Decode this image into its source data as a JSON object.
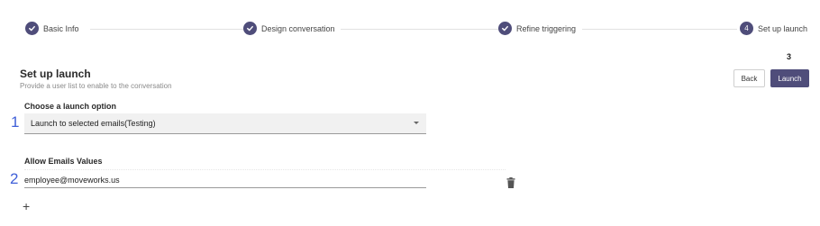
{
  "stepper": {
    "steps": [
      {
        "label": "Basic Info",
        "state": "done"
      },
      {
        "label": "Design conversation",
        "state": "done"
      },
      {
        "label": "Refine triggering",
        "state": "done"
      },
      {
        "label": "Set up launch",
        "state": "current",
        "number": "4"
      }
    ]
  },
  "header": {
    "title": "Set up launch",
    "subtitle": "Provide a user list to enable to the conversation"
  },
  "markers": {
    "one": "1",
    "two": "2",
    "three": "3"
  },
  "buttons": {
    "back": "Back",
    "launch": "Launch"
  },
  "launch_option": {
    "label": "Choose a launch option",
    "selected": "Launch to selected emails(Testing)"
  },
  "emails": {
    "label": "Allow Emails Values",
    "values": [
      "employee@moveworks.us"
    ]
  },
  "add_symbol": "+",
  "colors": {
    "accent": "#4f4d7a",
    "marker_blue": "#3f5fd8"
  }
}
